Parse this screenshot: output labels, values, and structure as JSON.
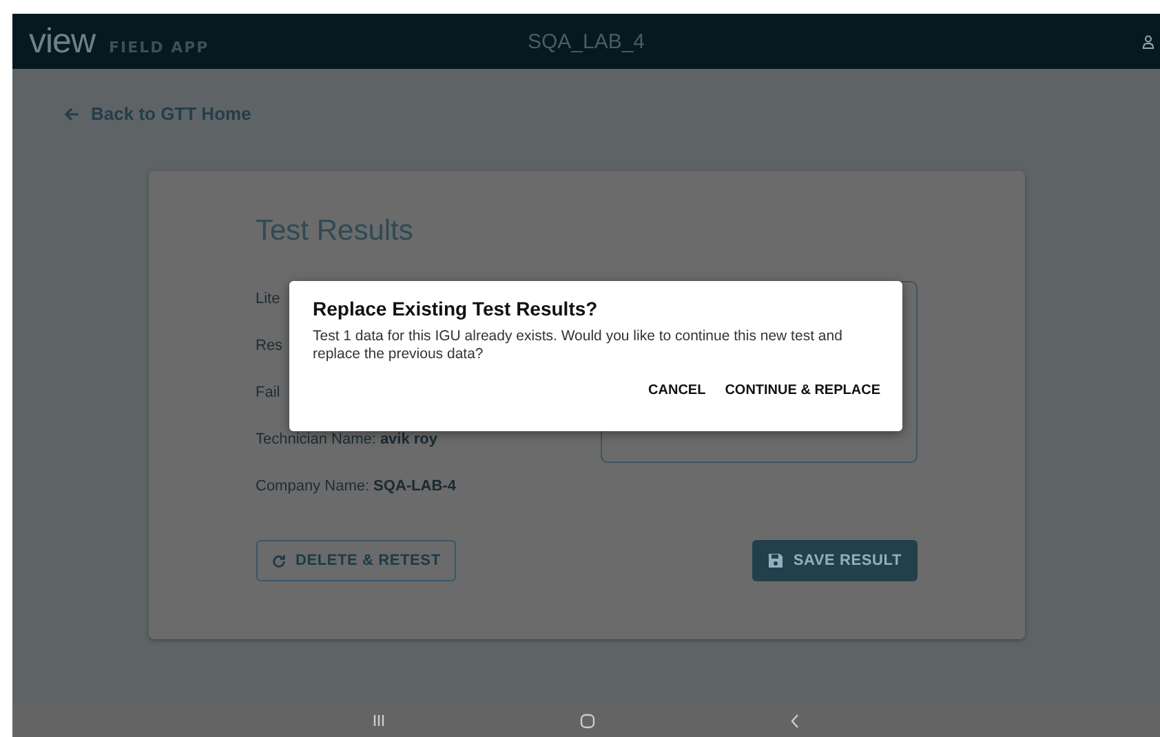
{
  "header": {
    "logo": "view",
    "subtitle": "FIELD APP",
    "title": "SQA_LAB_4"
  },
  "back_link": "Back to GTT Home",
  "card": {
    "title": "Test Results",
    "fields": [
      {
        "label": "Lite"
      },
      {
        "label": "Res"
      },
      {
        "label": "Fail"
      },
      {
        "label": "Technician Name:",
        "value": "avik roy"
      },
      {
        "label": "Company Name:",
        "value": "SQA-LAB-4"
      }
    ],
    "buttons": [
      {
        "kind": "outline",
        "label": "DELETE & RETEST"
      },
      {
        "kind": "filled",
        "label": "SAVE RESULT"
      }
    ]
  },
  "dialog": {
    "title": "Replace Existing Test Results?",
    "message": "Test 1 data for this IGU already exists. Would you like to continue this new test and replace the previous data?",
    "actions": [
      "CANCEL",
      "CONTINUE & REPLACE"
    ]
  }
}
